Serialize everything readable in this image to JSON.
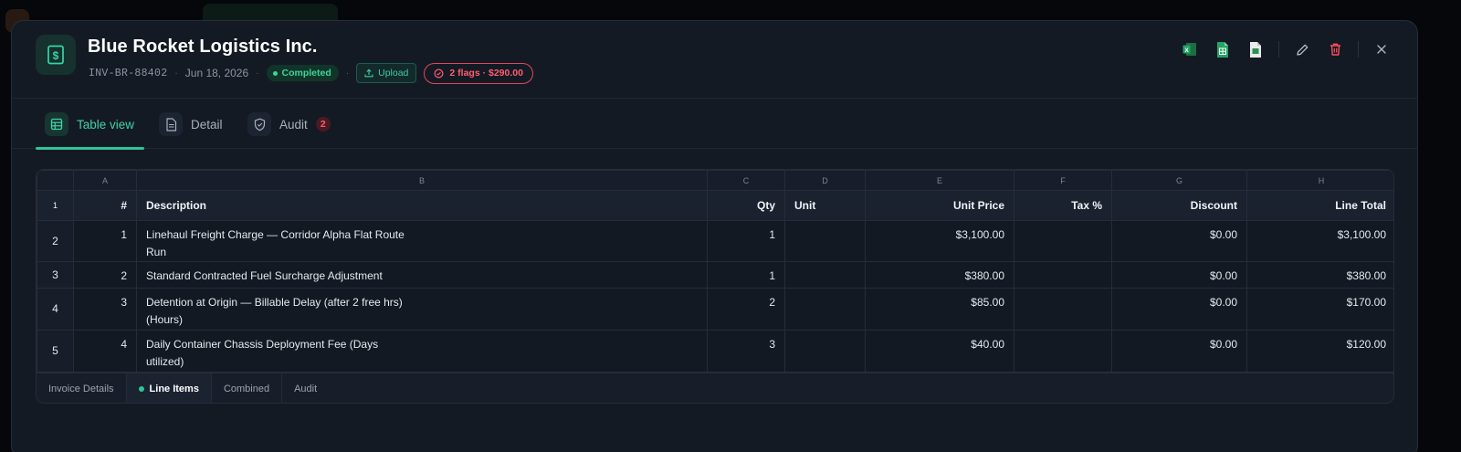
{
  "invoice": {
    "vendor": "Blue Rocket Logistics Inc.",
    "number": "INV-BR-88402",
    "date": "Jun 18, 2026",
    "status": "Completed",
    "upload_label": "Upload",
    "flags_label": "2 flags · $290.00"
  },
  "icons": {
    "logo": "invoice-dollar-icon",
    "actions": [
      "excel-export-icon",
      "sheets-export-icon",
      "document-export-icon",
      "edit-pencil-icon",
      "delete-trash-icon",
      "close-icon"
    ]
  },
  "tabs": [
    {
      "label": "Table view",
      "icon": "table-icon",
      "active": true
    },
    {
      "label": "Detail",
      "icon": "document-icon",
      "active": false
    },
    {
      "label": "Audit",
      "icon": "shield-icon",
      "active": false,
      "badge": "2"
    }
  ],
  "sheet": {
    "column_letters": [
      "A",
      "B",
      "C",
      "D",
      "E",
      "F",
      "G",
      "H"
    ],
    "row_numbers": [
      "1",
      "2",
      "3",
      "4",
      "5"
    ],
    "headers": [
      "#",
      "Description",
      "Qty",
      "Unit",
      "Unit Price",
      "Tax %",
      "Discount",
      "Line Total"
    ],
    "rows": [
      {
        "num": "1",
        "desc_line1": "Linehaul Freight Charge — Corridor Alpha Flat Route",
        "desc_line2": "Run",
        "qty": "1",
        "unit": "",
        "unit_price": "$3,100.00",
        "tax": "",
        "discount": "$0.00",
        "total": "$3,100.00"
      },
      {
        "num": "2",
        "desc_line1": "Standard Contracted Fuel Surcharge Adjustment",
        "desc_line2": "",
        "qty": "1",
        "unit": "",
        "unit_price": "$380.00",
        "tax": "",
        "discount": "$0.00",
        "total": "$380.00"
      },
      {
        "num": "3",
        "desc_line1": "Detention at Origin — Billable Delay (after 2 free hrs)",
        "desc_line2": "(Hours)",
        "qty": "2",
        "unit": "",
        "unit_price": "$85.00",
        "tax": "",
        "discount": "$0.00",
        "total": "$170.00"
      },
      {
        "num": "4",
        "desc_line1": "Daily Container Chassis Deployment Fee (Days",
        "desc_line2": "utilized)",
        "qty": "3",
        "unit": "",
        "unit_price": "$40.00",
        "tax": "",
        "discount": "$0.00",
        "total": "$120.00"
      }
    ],
    "sheet_tabs": [
      "Invoice Details",
      "Line Items",
      "Combined",
      "Audit"
    ],
    "active_sheet": "Line Items"
  },
  "colors": {
    "accent": "#2fc49a",
    "danger": "#ff5d6f",
    "modal_bg": "#141a24"
  }
}
